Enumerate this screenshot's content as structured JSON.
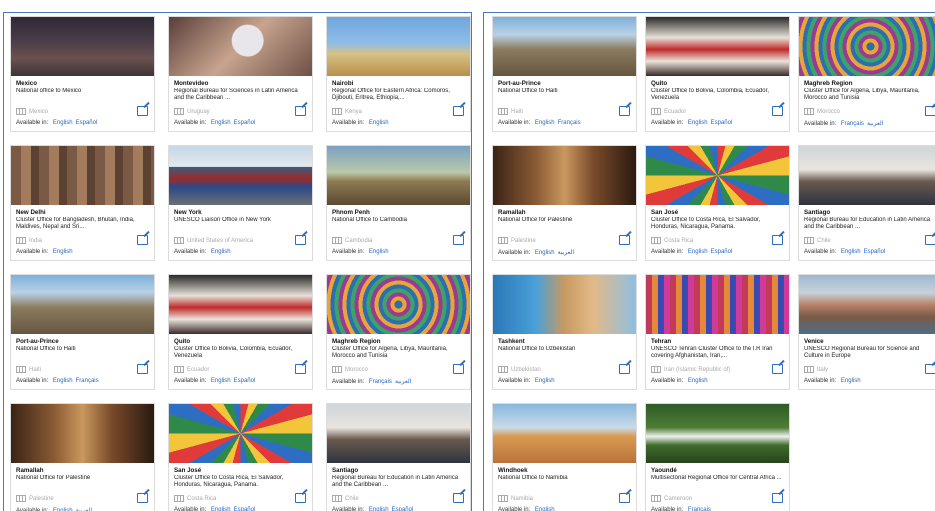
{
  "available_in_label": "Available in:",
  "left_panel": {
    "cards": [
      {
        "name": "Mexico",
        "desc": "National office to Mexico",
        "country": "Mexico",
        "langs": [
          "English",
          "Español"
        ],
        "thumb": "mexico"
      },
      {
        "name": "Montevideo",
        "desc": "Regional Bureau for Sciences in Latin America and the Caribbean ...",
        "country": "Uruguay",
        "langs": [
          "English",
          "Español"
        ],
        "thumb": "montevideo"
      },
      {
        "name": "Nairobi",
        "desc": "Regional Office for Eastern Africa: Comoros, Djibouti, Eritrea, Ethiopia,...",
        "country": "Kenya",
        "langs": [
          "English"
        ],
        "thumb": "nairobi"
      },
      {
        "name": "New Delhi",
        "desc": "Cluster Office for Bangladesh, Bhutan, India, Maldives, Nepal and Sri...",
        "country": "India",
        "langs": [
          "English"
        ],
        "thumb": "newdelhi"
      },
      {
        "name": "New York",
        "desc": "UNESCO Liaison Office in New York",
        "country": "United States of America",
        "langs": [
          "English"
        ],
        "thumb": "newyork"
      },
      {
        "name": "Phnom Penh",
        "desc": "National Office to Cambodia",
        "country": "Cambodia",
        "langs": [
          "English"
        ],
        "thumb": "phnompenh"
      },
      {
        "name": "Port-au-Prince",
        "desc": "National Office to Haiti",
        "country": "Haiti",
        "langs": [
          "English",
          "Français"
        ],
        "thumb": "haiti"
      },
      {
        "name": "Quito",
        "desc": "Cluster Office to Bolivia, Colombia, Ecuador, Venezuela",
        "country": "Ecuador",
        "langs": [
          "English",
          "Español"
        ],
        "thumb": "quito"
      },
      {
        "name": "Maghreb Region",
        "desc": "Cluster Office for Algeria, Libya, Mauritania, Morocco and Tunisia",
        "country": "Morocco",
        "langs": [
          "Français",
          "العربية"
        ],
        "thumb": "maghreb"
      },
      {
        "name": "Ramallah",
        "desc": "National Office for Palestine",
        "country": "Palestine",
        "langs": [
          "English",
          "العربية"
        ],
        "thumb": "ramallah"
      },
      {
        "name": "San José",
        "desc": "Cluster Office to Costa Rica, El Salvador, Honduras, Nicaragua, Panama.",
        "country": "Costa Rica",
        "langs": [
          "English",
          "Español"
        ],
        "thumb": "sanjose"
      },
      {
        "name": "Santiago",
        "desc": "Regional Bureau for Education in Latin America and the Caribbean ...",
        "country": "Chile",
        "langs": [
          "English",
          "Español"
        ],
        "thumb": "santiago"
      }
    ]
  },
  "right_panel": {
    "cards": [
      {
        "name": "Port-au-Prince",
        "desc": "National Office to Haiti",
        "country": "Haiti",
        "langs": [
          "English",
          "Français"
        ],
        "thumb": "haiti"
      },
      {
        "name": "Quito",
        "desc": "Cluster Office to Bolivia, Colombia, Ecuador, Venezuela",
        "country": "Ecuador",
        "langs": [
          "English",
          "Español"
        ],
        "thumb": "quito"
      },
      {
        "name": "Maghreb Region",
        "desc": "Cluster Office for Algeria, Libya, Mauritania, Morocco and Tunisia",
        "country": "Morocco",
        "langs": [
          "Français",
          "العربية"
        ],
        "thumb": "maghreb"
      },
      {
        "name": "Ramallah",
        "desc": "National Office for Palestine",
        "country": "Palestine",
        "langs": [
          "English",
          "العربية"
        ],
        "thumb": "ramallah"
      },
      {
        "name": "San José",
        "desc": "Cluster Office to Costa Rica, El Salvador, Honduras, Nicaragua, Panama.",
        "country": "Costa Rica",
        "langs": [
          "English",
          "Español"
        ],
        "thumb": "sanjose"
      },
      {
        "name": "Santiago",
        "desc": "Regional Bureau for Education in Latin America and the Caribbean ...",
        "country": "Chile",
        "langs": [
          "English",
          "Español"
        ],
        "thumb": "santiago"
      },
      {
        "name": "Tashkent",
        "desc": "National Office to Uzbekistan",
        "country": "Uzbekistan",
        "langs": [
          "English"
        ],
        "thumb": "tashkent"
      },
      {
        "name": "Tehran",
        "desc": "UNESCO Tehran Cluster Office to the I.R Iran covering Afghanistan, Iran,...",
        "country": "Iran (Islamic Republic of)",
        "langs": [
          "English"
        ],
        "thumb": "tehran"
      },
      {
        "name": "Venice",
        "desc": "UNESCO Regional Bureau for Science and Culture in Europe",
        "country": "Italy",
        "langs": [
          "English"
        ],
        "thumb": "venice"
      },
      {
        "name": "Windhoek",
        "desc": "National Office to Namibia",
        "country": "Namibia",
        "langs": [
          "English"
        ],
        "thumb": "windhoek"
      },
      {
        "name": "Yaoundé",
        "desc": "Multisectorial Regional Office for Central Africa ...",
        "country": "Cameroon",
        "langs": [
          "Français"
        ],
        "thumb": "yaounde"
      }
    ]
  },
  "colors": {
    "panel_border": "#4a76c6",
    "link": "#2a66c2",
    "edit_icon": "#2f6ebd"
  }
}
